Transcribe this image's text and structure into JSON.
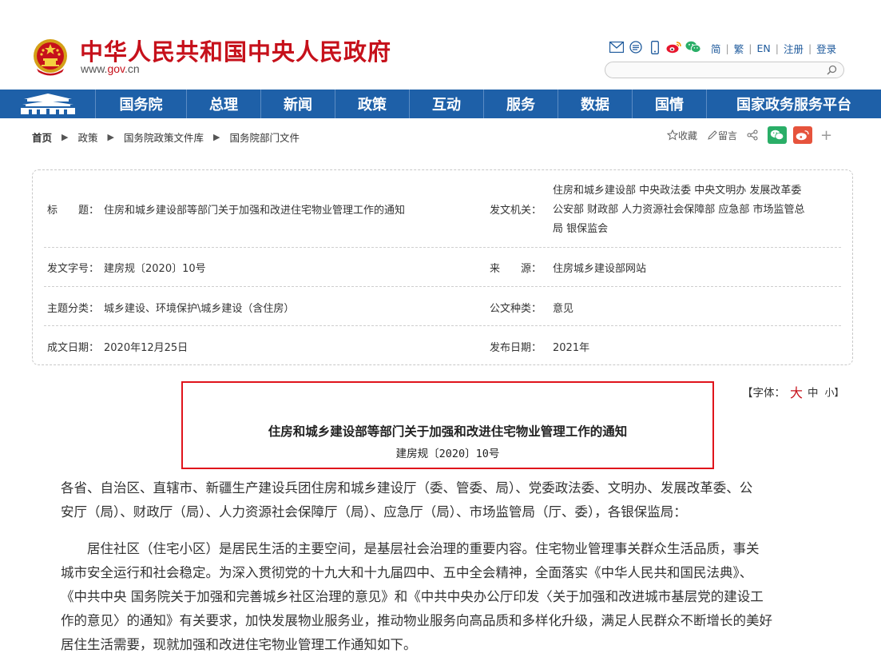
{
  "header": {
    "site_title": "中华人民共和国中央人民政府",
    "site_url_prefix": "www.",
    "site_url_domain": "gov",
    "site_url_suffix": ".cn",
    "top_links": [
      "简",
      "繁",
      "EN",
      "注册",
      "登录"
    ],
    "top_icons": [
      "mail-icon",
      "app-icon",
      "mobile-icon",
      "weibo-icon",
      "wechat-icon"
    ],
    "search_placeholder": ""
  },
  "nav": {
    "items": [
      "国务院",
      "总理",
      "新闻",
      "政策",
      "互动",
      "服务",
      "数据",
      "国情",
      "国家政务服务平台"
    ]
  },
  "breadcrumb": {
    "items": [
      "首页",
      "政策",
      "国务院政策文件库",
      "国务院部门文件"
    ]
  },
  "tools": {
    "favorite": "收藏",
    "comment": "留言",
    "add": "+"
  },
  "info": {
    "title_label": "标　　题：",
    "title_value": "住房和城乡建设部等部门关于加强和改进住宅物业管理工作的通知",
    "issuer_label": "发文机关：",
    "issuer_value_line1": "住房和城乡建设部 中央政法委 中央文明办 发展改革委",
    "issuer_value_line2": "公安部 财政部 人力资源社会保障部 应急部 市场监管总",
    "issuer_value_line3": "局 银保监会",
    "doc_no_label": "发文字号：",
    "doc_no_value": "建房规〔2020〕10号",
    "source_label": "来　　源：",
    "source_value": "住房城乡建设部网站",
    "topic_label": "主题分类：",
    "topic_value": "城乡建设、环境保护\\城乡建设（含住房）",
    "type_label": "公文种类：",
    "type_value": "意见",
    "written_label": "成文日期：",
    "written_value": "2020年12月25日",
    "publish_label": "发布日期：",
    "publish_value": "2021年"
  },
  "font_size": {
    "prefix": "【字体：",
    "large": "大",
    "medium": "中",
    "small": "小】"
  },
  "document": {
    "title": "住房和城乡建设部等部门关于加强和改进住宅物业管理工作的通知",
    "number": "建房规〔2020〕10号",
    "para1_line1": "各省、自治区、直辖市、新疆生产建设兵团住房和城乡建设厅（委、管委、局）、党委政法委、文明办、发展改革委、公",
    "para1_line2": "安厅（局）、财政厅（局）、人力资源社会保障厅（局）、应急厅（局）、市场监管局（厅、委），各银保监局：",
    "para2_line1": "　　居住社区（住宅小区）是居民生活的主要空间，是基层社会治理的重要内容。住宅物业管理事关群众生活品质，事关",
    "para2_line2": "城市安全运行和社会稳定。为深入贯彻党的十九大和十九届四中、五中全会精神，全面落实《中华人民共和国民法典》、",
    "para2_line3": "《中共中央 国务院关于加强和完善城乡社区治理的意见》和《中共中央办公厅印发〈关于加强和改进城市基层党的建设工",
    "para2_line4": "作的意见〉的通知》有关要求，加快发展物业服务业，推动物业服务向高品质和多样化升级，满足人民群众不断增长的美好",
    "para2_line5": "居住生活需要，现就加强和改进住宅物业管理工作通知如下。"
  }
}
